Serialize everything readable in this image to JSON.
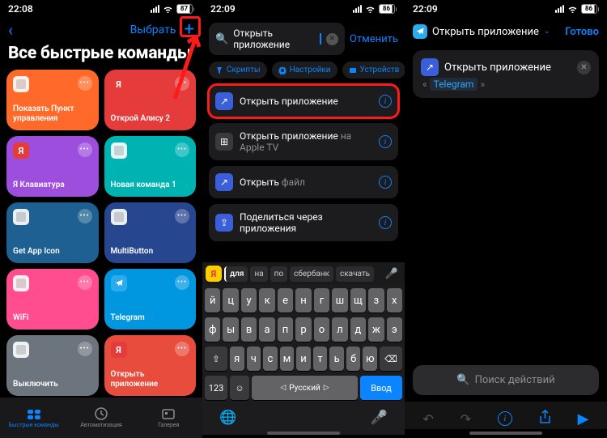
{
  "pane1": {
    "status": {
      "time": "22:08",
      "battery": "87"
    },
    "nav": {
      "select": "Выбрать"
    },
    "title": "Все быстрые команды",
    "cards": [
      {
        "label": "Показать Пункт управления",
        "color": "c-orange"
      },
      {
        "label": "Открой Алису 2",
        "color": "c-red",
        "icon": "Я",
        "iconClass": "ya-icon"
      },
      {
        "label": "Я Клавиатура",
        "color": "c-purple",
        "icon": "Я",
        "iconClass": "ya-icon"
      },
      {
        "label": "Новая команда 1",
        "color": "c-teal"
      },
      {
        "label": "Get App Icon",
        "color": "c-blue"
      },
      {
        "label": "MultiButton",
        "color": "c-navy"
      },
      {
        "label": "WiFi",
        "color": "c-pink"
      },
      {
        "label": "Telegram",
        "color": "c-cyan",
        "icon": "tg"
      },
      {
        "label": "Выключить",
        "color": "c-gray"
      },
      {
        "label": "Открыть приложение",
        "color": "c-ored",
        "icon": "Я",
        "iconClass": "ya-icon"
      }
    ],
    "tabs": [
      {
        "label": "Быстрые команды",
        "active": true
      },
      {
        "label": "Автоматизация",
        "active": false
      },
      {
        "label": "Галерея",
        "active": false
      }
    ]
  },
  "pane2": {
    "status": {
      "time": "22:09",
      "battery": "86"
    },
    "search": {
      "query": "Открыть приложение",
      "cancel": "Отменить"
    },
    "filters": [
      "Скрипты",
      "Настройки",
      "Устройств"
    ],
    "results": [
      {
        "label": "Открыть приложение",
        "highlight": true,
        "iconColor": "ri-blue",
        "iconGlyph": "↗"
      },
      {
        "label": "Открыть приложение",
        "sub": " на Apple TV",
        "iconColor": "ri-dark",
        "iconGlyph": "⊞"
      },
      {
        "label": "Открыть",
        "sub2": " файл",
        "iconColor": "ri-blue",
        "iconGlyph": "↗"
      },
      {
        "label": "Поделиться через приложения",
        "iconColor": "ri-blue",
        "iconGlyph": "⇪"
      }
    ],
    "suggestions": [
      "для",
      "на",
      "по",
      "сбербанк",
      "скачать"
    ],
    "suggFirst": "Я",
    "kbRows": [
      [
        "й",
        "ц",
        "у",
        "к",
        "е",
        "н",
        "г",
        "ш",
        "щ",
        "з",
        "х"
      ],
      [
        "ф",
        "ы",
        "в",
        "а",
        "п",
        "р",
        "о",
        "л",
        "д",
        "ж",
        "э"
      ],
      [
        "я",
        "ч",
        "с",
        "м",
        "и",
        "т",
        "ь",
        "б",
        "ю"
      ]
    ],
    "numKey": "123",
    "spaceLabel": "Русский",
    "doneKey": "Ввод"
  },
  "pane3": {
    "status": {
      "time": "22:09",
      "battery": "86"
    },
    "nav": {
      "title": "Открыть приложение",
      "done": "Готово"
    },
    "action": {
      "label": "Открыть приложение",
      "appName": "Telegram"
    },
    "searchPlaceholder": "Поиск действий"
  }
}
